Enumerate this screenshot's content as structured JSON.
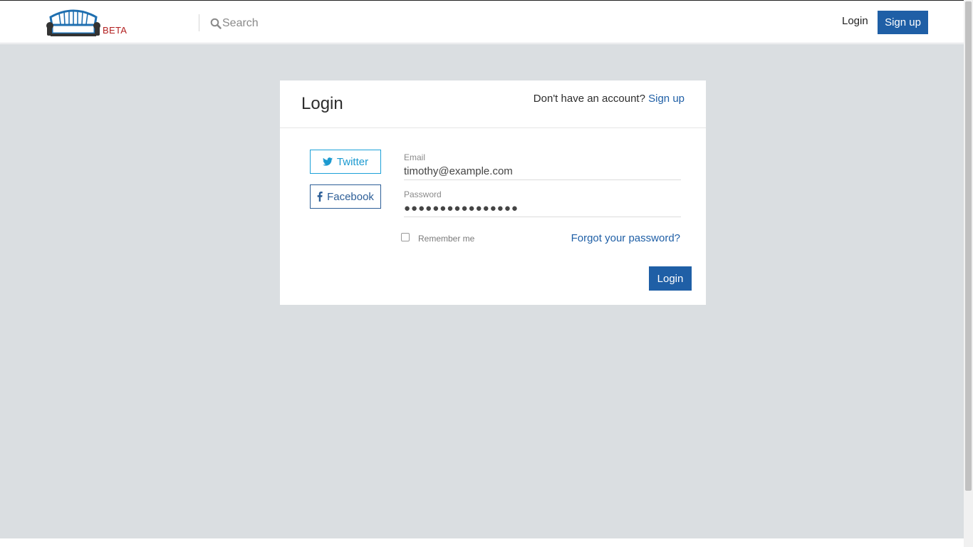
{
  "header": {
    "logo_badge": "BETA",
    "search": {
      "placeholder": "Search",
      "value": ""
    },
    "login_label": "Login",
    "signup_label": "Sign up"
  },
  "login_card": {
    "title": "Login",
    "signup_prompt": "Don't have an account?",
    "signup_link": "Sign up",
    "social": {
      "twitter_label": "Twitter",
      "facebook_label": "Facebook"
    },
    "email": {
      "label": "Email",
      "value": "timothy@example.com"
    },
    "password": {
      "label": "Password",
      "masked_value": "●●●●●●●●●●●●●●●●"
    },
    "remember": {
      "label": "Remember me",
      "checked": false
    },
    "forgot_label": "Forgot your password?",
    "submit_label": "Login"
  },
  "colors": {
    "primary": "#1f5fa6",
    "twitter": "#1da1d8",
    "facebook": "#2d5e97",
    "background": "#dadee1",
    "beta": "#b21f1f"
  },
  "icons": {
    "logo": "armchair-logo-icon",
    "search": "search-icon",
    "twitter": "twitter-icon",
    "facebook": "facebook-icon"
  }
}
